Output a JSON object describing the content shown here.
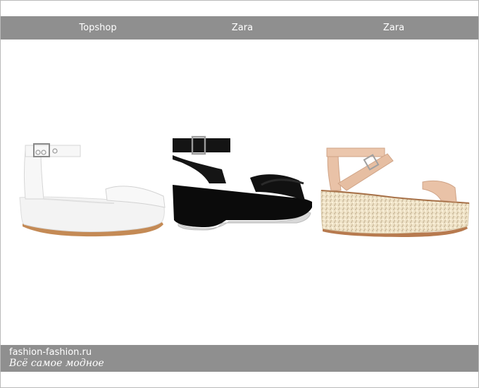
{
  "header": {
    "brands": [
      "Topshop",
      "Zara",
      "Zara"
    ]
  },
  "products": [
    {
      "brand": "Topshop",
      "description": "white platform sandal",
      "colors": {
        "upper": "#f6f6f6",
        "sole": "#eeeeee",
        "outsole": "#c48a55",
        "buckle": "#8a8a8a"
      }
    },
    {
      "brand": "Zara",
      "description": "black platform sandal",
      "colors": {
        "upper": "#121212",
        "sole": "#0b0b0b",
        "outsole": "#cfcfcf",
        "buckle": "#9a9a9a"
      }
    },
    {
      "brand": "Zara",
      "description": "nude glitter platform sandal",
      "colors": {
        "upper": "#e9c2a7",
        "sole": "#efe3c8",
        "outsole": "#b77a4f",
        "buckle": "#a0a0a0"
      }
    }
  ],
  "footer": {
    "site": "fashion-fashion.ru",
    "tagline": "Всё самое модное"
  }
}
